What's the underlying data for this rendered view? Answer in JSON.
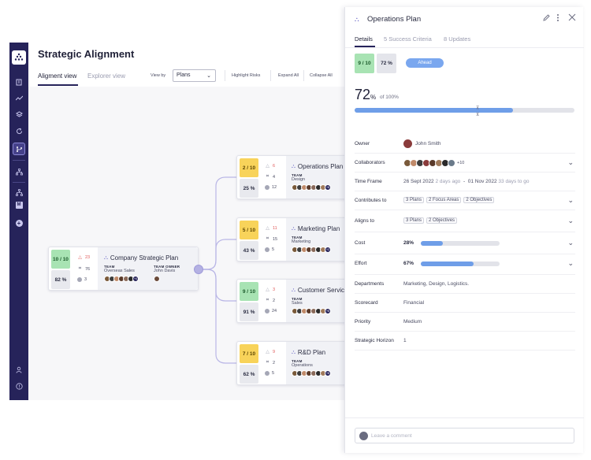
{
  "page": {
    "title": "Strategic Alignment",
    "tabs": [
      {
        "label": "Aligment view"
      },
      {
        "label": "Explorer view"
      }
    ],
    "view_by_label": "View by",
    "view_by_value": "Plans",
    "highlight_risks": "Highlight Risks",
    "expand_all": "Expand All",
    "collapse_all": "Collapse All"
  },
  "leftbar": {
    "icons": [
      "logo-icon",
      "building-icon",
      "trend-icon",
      "layers-icon",
      "refresh-icon",
      "branch-icon",
      "hierarchy-icon",
      "hierarchy-alt-icon",
      "m-badge-icon",
      "add-icon",
      "user-settings-icon",
      "help-icon"
    ],
    "m_badge": "M",
    "add": "+"
  },
  "root": {
    "score": "10 / 10",
    "progress": "82 %",
    "risks": "23",
    "targets": "76",
    "items": "3",
    "title": "Company Strategic Plan",
    "team_label": "TEAM",
    "team": "Overseas Sales",
    "owner_label": "TEAM OWNER",
    "owner": "John Davis",
    "more": "+4",
    "colors": {
      "score_bg": "#a8e3b3"
    }
  },
  "children": [
    {
      "score": "2 / 10",
      "progress": "25 %",
      "risks": "6",
      "targets": "4",
      "items": "12",
      "title": "Operations Plan",
      "team_label": "TEAM",
      "team": "Design",
      "more": "+8",
      "color": "yellow"
    },
    {
      "score": "5 / 10",
      "progress": "43 %",
      "risks": "11",
      "targets": "15",
      "items": "5",
      "title": "Marketing Plan",
      "team_label": "TEAM",
      "team": "Marketing",
      "more": "+2",
      "color": "yellow"
    },
    {
      "score": "9 / 10",
      "progress": "91 %",
      "risks": "3",
      "targets": "2",
      "items": "24",
      "title": "Customer Service",
      "team_label": "TEAM",
      "team": "Sales",
      "more": "+8",
      "color": "green"
    },
    {
      "score": "7 / 10",
      "progress": "62 %",
      "risks": "9",
      "targets": "2",
      "items": "5",
      "title": "R&D Plan",
      "team_label": "TEAM",
      "team": "Operations",
      "more": "+8",
      "color": "yellow"
    }
  ],
  "panel": {
    "title": "Operations Plan",
    "tabs": [
      {
        "label": "Details"
      },
      {
        "label": "5 Success Criteria"
      },
      {
        "label": "8 Updates"
      }
    ],
    "score": "9 / 10",
    "progress_label": "72 %",
    "status": "Ahead",
    "big_value": "72",
    "big_unit": "%",
    "of_text": "of 100%",
    "progress_fraction": 0.72,
    "target_fraction": 0.56,
    "rows": {
      "owner": {
        "label": "Owner",
        "value": "John Smith"
      },
      "collaborators": {
        "label": "Collaborators",
        "more": "+10"
      },
      "time_frame": {
        "label": "Time Frame",
        "start": "26 Sept 2022",
        "start_ago": "2 days ago",
        "dash": "-",
        "end": "01 Nov 2022",
        "end_ago": "33 days to go"
      },
      "contributes": {
        "label": "Contributes to",
        "chips": [
          "3 Plans",
          "2 Focus Areas",
          "2 Objectives"
        ]
      },
      "aligns": {
        "label": "Aligns to",
        "chips": [
          "3 Plans",
          "2 Objectives"
        ]
      },
      "cost": {
        "label": "Cost",
        "value": "28%",
        "fraction": 0.28
      },
      "effort": {
        "label": "Effort",
        "value": "67%",
        "fraction": 0.67
      },
      "departments": {
        "label": "Departments",
        "value": "Marketing, Design, Logistics."
      },
      "scorecard": {
        "label": "Scorecard",
        "value": "Financial"
      },
      "priority": {
        "label": "Priority",
        "value": "Medium"
      },
      "horizon": {
        "label": "Strategic Horizon",
        "value": "1"
      }
    },
    "comment_placeholder": "Leave a comment"
  },
  "colors": {
    "sidebar": "#26235a",
    "green": "#a8e3b3",
    "yellow": "#f8d35a",
    "accent_blue": "#6f9ee8",
    "badge_blue": "#7aa7ef",
    "risk_red": "#e05a5a"
  }
}
